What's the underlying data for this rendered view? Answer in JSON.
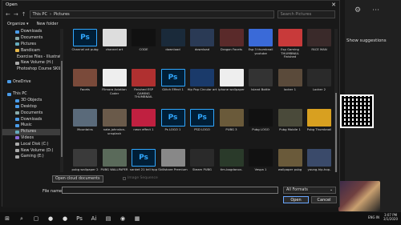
{
  "window": {
    "title": "Open",
    "close": "✕"
  },
  "address": {
    "back": "←",
    "forward": "→",
    "up": "↑",
    "path": [
      "This PC",
      "Pictures"
    ],
    "search_placeholder": "Search Pictures"
  },
  "toolbar": {
    "organize": "Organize ▾",
    "new_folder": "New folder"
  },
  "nav": [
    {
      "label": "Downloads",
      "color": "#4a9be8",
      "level": 1
    },
    {
      "label": "Documents",
      "color": "#8aa",
      "level": 1
    },
    {
      "label": "Pictures",
      "color": "#6ab",
      "level": 1
    },
    {
      "label": "Bandicam",
      "color": "#e6b84a",
      "level": 1
    },
    {
      "label": "Exercise Files - Illustrator E",
      "color": "#e6b84a",
      "level": 1
    },
    {
      "label": "New Volume (H:)",
      "color": "#aaa",
      "level": 1
    },
    {
      "label": "Photoshop Course SKILLSHA",
      "color": "#e6b84a",
      "level": 1
    },
    {
      "label": "",
      "color": "",
      "level": 1
    },
    {
      "label": "OneDrive",
      "color": "#4a9be8",
      "level": 0
    },
    {
      "label": "",
      "color": "",
      "level": 1
    },
    {
      "label": "This PC",
      "color": "#4a9be8",
      "level": 0
    },
    {
      "label": "3D Objects",
      "color": "#4a9be8",
      "level": 1
    },
    {
      "label": "Desktop",
      "color": "#4a9be8",
      "level": 1
    },
    {
      "label": "Documents",
      "color": "#8aa",
      "level": 1
    },
    {
      "label": "Downloads",
      "color": "#4a9be8",
      "level": 1
    },
    {
      "label": "Music",
      "color": "#4a9be8",
      "level": 1
    },
    {
      "label": "Pictures",
      "color": "#6ab",
      "level": 1,
      "selected": true
    },
    {
      "label": "Videos",
      "color": "#8a6ad8",
      "level": 1
    },
    {
      "label": "Local Disk (C:)",
      "color": "#aaa",
      "level": 1
    },
    {
      "label": "New Volume (D:)",
      "color": "#aaa",
      "level": 1
    },
    {
      "label": "Gaming (E:)",
      "color": "#aaa",
      "level": 1
    }
  ],
  "files": [
    {
      "name": "Channel art pubg",
      "kind": "ps"
    },
    {
      "name": "channel art",
      "kind": "img",
      "color": "#ddd"
    },
    {
      "name": "CODE",
      "kind": "img",
      "color": "#111"
    },
    {
      "name": "download",
      "kind": "img",
      "color": "#1a2a3a"
    },
    {
      "name": "download",
      "kind": "img",
      "color": "#2a3a55"
    },
    {
      "name": "Dragon Facets",
      "kind": "img",
      "color": "#5a2a2a"
    },
    {
      "name": "Esp 3 thumbnail youtube",
      "kind": "img",
      "color": "#3a6ad8"
    },
    {
      "name": "Esp Gaming THUMBNAIL Finished",
      "kind": "img",
      "color": "#c83a3a"
    },
    {
      "name": "FACE MAN",
      "kind": "img",
      "color": "#3a2a2a"
    },
    {
      "name": "Facets",
      "kind": "img",
      "color": "#7a4a3a"
    },
    {
      "name": "Filmora Aviation Coder",
      "kind": "img",
      "color": "#eee"
    },
    {
      "name": "Finished ESP GAMING THUMBNAIL",
      "kind": "img",
      "color": "#b03030"
    },
    {
      "name": "Glitch Effect 1",
      "kind": "ps"
    },
    {
      "name": "Hip Pop Circular art",
      "kind": "img",
      "color": "#1a3a6a"
    },
    {
      "name": "iphone wallpaper",
      "kind": "img",
      "color": "#eee"
    },
    {
      "name": "Island Bottle",
      "kind": "img",
      "color": "#333"
    },
    {
      "name": "locker 1",
      "kind": "img",
      "color": "#5a4a3a"
    },
    {
      "name": "Locker 2",
      "kind": "img",
      "color": "#2a2a2a"
    },
    {
      "name": "Mountains",
      "kind": "img",
      "color": "#5a6a7a"
    },
    {
      "name": "nate-johnston-unsplash",
      "kind": "img",
      "color": "#6a5a4a"
    },
    {
      "name": "neon effect 1",
      "kind": "img",
      "color": "#c02040"
    },
    {
      "name": "Ps LOGO 1",
      "kind": "ps"
    },
    {
      "name": "PSD LOGO",
      "kind": "ps"
    },
    {
      "name": "PUBG 3",
      "kind": "img",
      "color": "#6a5a3a"
    },
    {
      "name": "Pubg LOGO",
      "kind": "img",
      "color": "#111"
    },
    {
      "name": "Pubg Mobile 1",
      "kind": "img",
      "color": "#4a4a3a"
    },
    {
      "name": "Pubg Thumbnail",
      "kind": "img",
      "color": "#d8a020"
    },
    {
      "name": "pubg wallpaper 2",
      "kind": "img",
      "color": "#3a3a3a"
    },
    {
      "name": "PUBG WALLPAPER",
      "kind": "img",
      "color": "#5a6a5a"
    },
    {
      "name": "sanket 21 tell hpp",
      "kind": "ps"
    },
    {
      "name": "Skillshare Premium minutes",
      "kind": "img",
      "color": "#888"
    },
    {
      "name": "Steam PUBG",
      "kind": "img",
      "color": "#2a2a2a"
    },
    {
      "name": "tim-bogdanov-dup8MkvcaU-unsplash",
      "kind": "img",
      "color": "#2a3a2a"
    },
    {
      "name": "Vespa 1",
      "kind": "img",
      "color": "#111"
    },
    {
      "name": "wallpaper pubg",
      "kind": "img",
      "color": "#6a5a3a"
    },
    {
      "name": "young-hip-hop-dancer",
      "kind": "img",
      "color": "#3a4a6a"
    }
  ],
  "bottom": {
    "cloud_btn": "Open cloud documents",
    "image_sequence": "Image Sequence",
    "file_name_label": "File name:",
    "file_name_value": "",
    "filter": "All Formats",
    "open": "Open",
    "cancel": "Cancel"
  },
  "side": {
    "show_suggestions": "Show suggestions",
    "icons": [
      "⚙",
      "⋯"
    ]
  },
  "taskbar": {
    "icons": [
      "⊞",
      "⌕",
      "▢",
      "●",
      "●",
      "Ps",
      "Ai",
      "▤",
      "◉",
      "▦"
    ],
    "lang": "ENG IN",
    "time": "3:07 PM",
    "date": "3/1/2020"
  }
}
